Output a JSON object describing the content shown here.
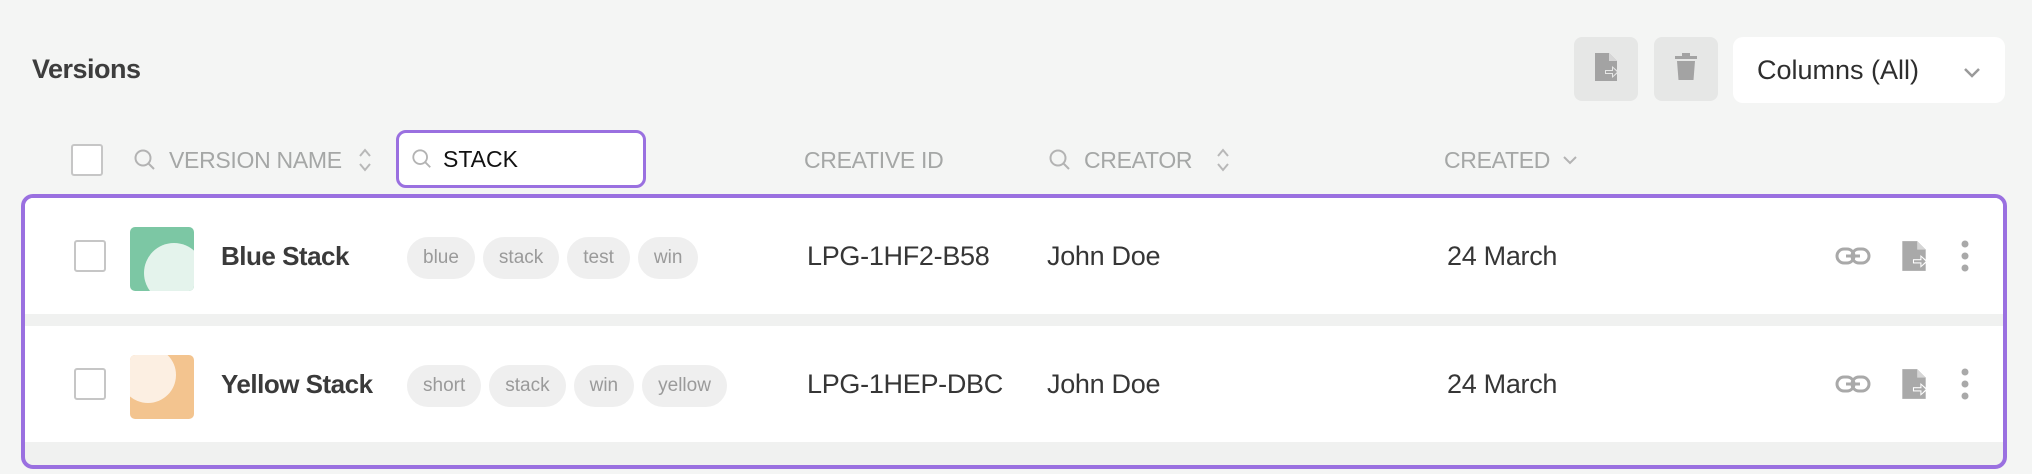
{
  "page": {
    "title": "Versions"
  },
  "toolbar": {
    "export_icon": "file-export-icon",
    "delete_icon": "trash-icon",
    "columns_label": "Columns (All)"
  },
  "header": {
    "version_name": "VERSION NAME",
    "search_value": "STACK",
    "creative_id": "CREATIVE ID",
    "creator": "CREATOR",
    "created": "CREATED"
  },
  "rows": [
    {
      "name": "Blue Stack",
      "tags": [
        "blue",
        "stack",
        "test",
        "win"
      ],
      "creative_id": "LPG-1HF2-B58",
      "creator": "John Doe",
      "created": "24 March",
      "thumb_bg": "#7cc7a4",
      "thumb_circle": "#e4f3ec"
    },
    {
      "name": "Yellow Stack",
      "tags": [
        "short",
        "stack",
        "win",
        "yellow"
      ],
      "creative_id": "LPG-1HEP-DBC",
      "creator": "John Doe",
      "created": "24 March",
      "thumb_bg": "#f3c48f",
      "thumb_circle": "#fcefe2"
    }
  ],
  "colors": {
    "accent": "#9a70e0",
    "background": "#f4f5f4",
    "muted_text": "#a5a7a6"
  }
}
